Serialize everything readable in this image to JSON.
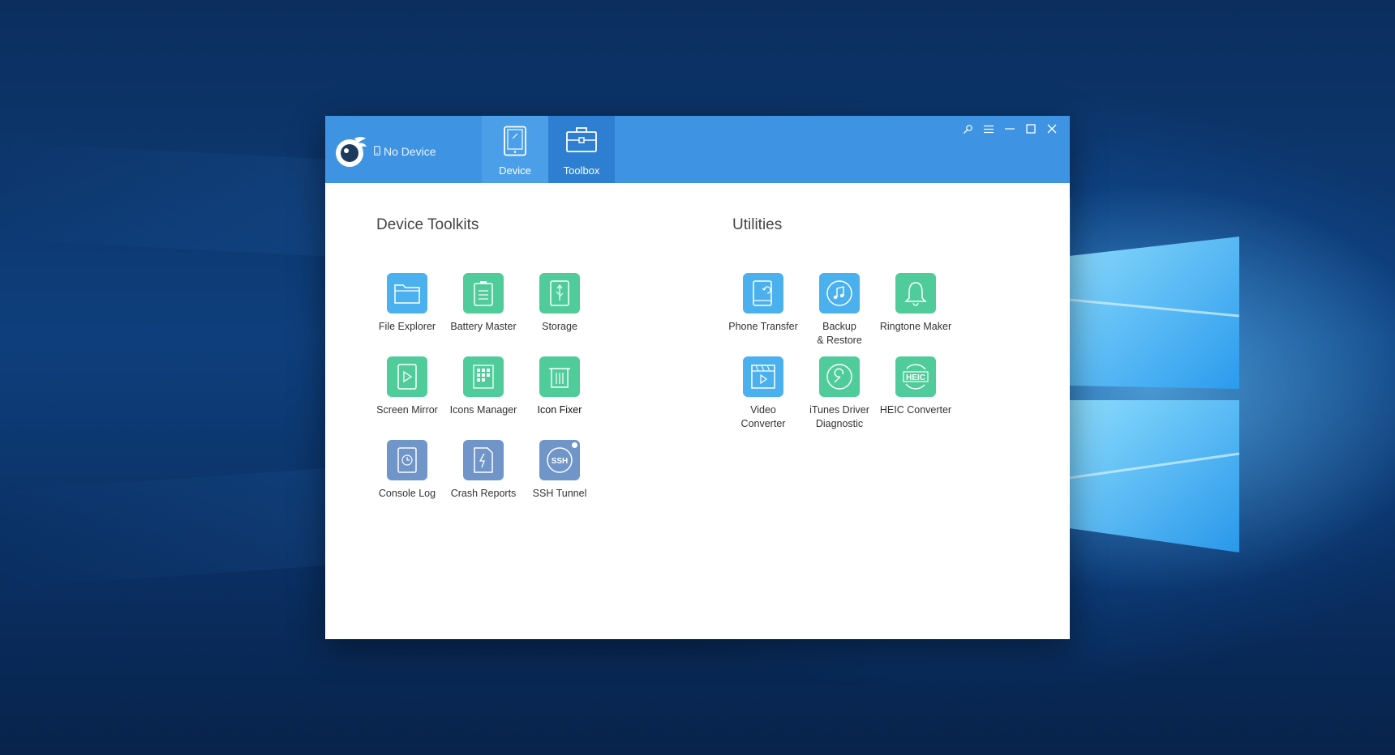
{
  "app": {
    "device_status": "No Device",
    "tabs": [
      {
        "label": "Device",
        "icon": "tablet-icon"
      },
      {
        "label": "Toolbox",
        "icon": "toolbox-icon"
      }
    ]
  },
  "sections": {
    "device_toolkits": {
      "title": "Device Toolkits",
      "tools": [
        {
          "label": "File Explorer",
          "icon": "folder-icon",
          "color": "#4ab1ee"
        },
        {
          "label": "Battery Master",
          "icon": "battery-icon",
          "color": "#4fcc9a"
        },
        {
          "label": "Storage",
          "icon": "usb-storage-icon",
          "color": "#4fcc9a"
        },
        {
          "label": "Screen Mirror",
          "icon": "play-icon",
          "color": "#4fcc9a"
        },
        {
          "label": "Icons Manager",
          "icon": "grid-icon",
          "color": "#4fcc9a"
        },
        {
          "label": "Icon Fixer",
          "icon": "trash-icon",
          "color": "#4fcc9a"
        },
        {
          "label": "Console Log",
          "icon": "clock-icon",
          "color": "#6f95c9"
        },
        {
          "label": "Crash Reports",
          "icon": "bolt-icon",
          "color": "#6f95c9"
        },
        {
          "label": "SSH Tunnel",
          "icon": "ssh-icon",
          "color": "#6f95c9",
          "ssh_text": "SSH"
        }
      ]
    },
    "utilities": {
      "title": "Utilities",
      "tools": [
        {
          "label": "Phone Transfer",
          "icon": "phone-transfer-icon",
          "color": "#4ab1ee"
        },
        {
          "label": "Backup",
          "label2": "& Restore",
          "icon": "music-icon",
          "color": "#4ab1ee"
        },
        {
          "label": "Ringtone Maker",
          "icon": "bell-icon",
          "color": "#4fcc9a"
        },
        {
          "label": "Video",
          "label2": "Converter",
          "icon": "video-icon",
          "color": "#4ab1ee"
        },
        {
          "label": "iTunes Driver",
          "label2": "Diagnostic",
          "icon": "wrench-icon",
          "color": "#4fcc9a"
        },
        {
          "label": "HEIC Converter",
          "icon": "heic-icon",
          "color": "#4fcc9a",
          "heic_text": "HEIC"
        }
      ]
    }
  }
}
